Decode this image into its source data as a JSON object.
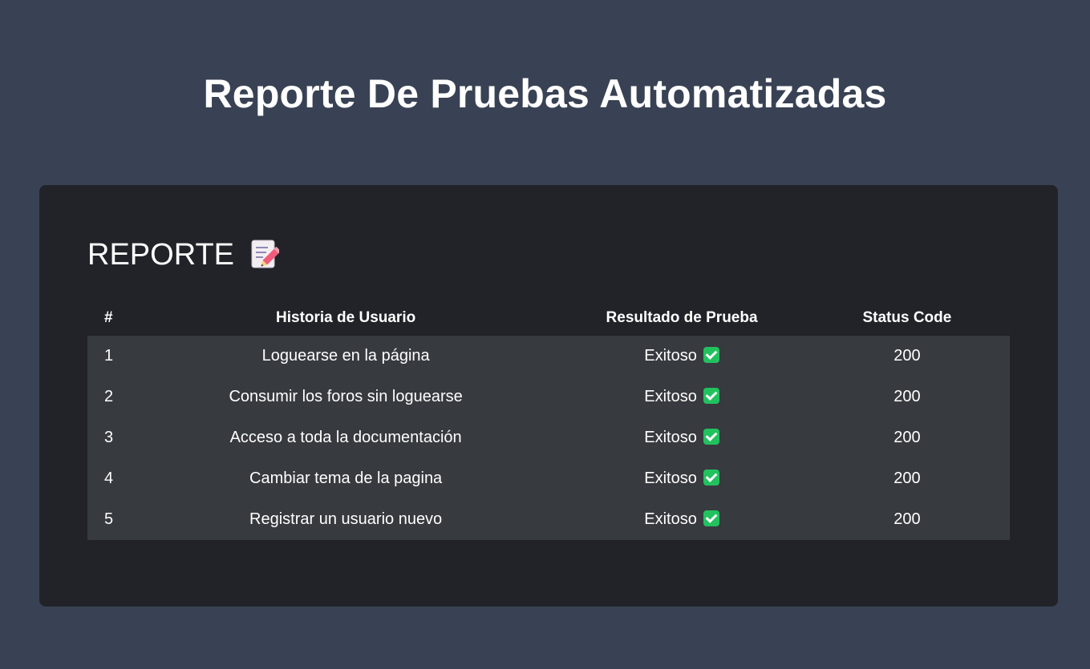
{
  "page": {
    "title": "Reporte De Pruebas Automatizadas"
  },
  "report": {
    "heading": "REPORTE",
    "heading_icon": "memo-pencil-icon",
    "columns": [
      "#",
      "Historia de Usuario",
      "Resultado de Prueba",
      "Status Code"
    ],
    "rows": [
      {
        "num": "1",
        "story": "Loguearse en la página",
        "result": "Exitoso",
        "status": "200"
      },
      {
        "num": "2",
        "story": "Consumir los foros sin loguearse",
        "result": "Exitoso",
        "status": "200"
      },
      {
        "num": "3",
        "story": "Acceso a toda la documentación",
        "result": "Exitoso",
        "status": "200"
      },
      {
        "num": "4",
        "story": "Cambiar tema de la pagina",
        "result": "Exitoso",
        "status": "200"
      },
      {
        "num": "5",
        "story": "Registrar un usuario nuevo",
        "result": "Exitoso",
        "status": "200"
      }
    ],
    "result_icon": "check-mark-icon"
  },
  "colors": {
    "page_background": "#394254",
    "card_background": "#212328",
    "row_background": "#373a3e",
    "success_green": "#21c25e",
    "text": "#ffffff"
  }
}
